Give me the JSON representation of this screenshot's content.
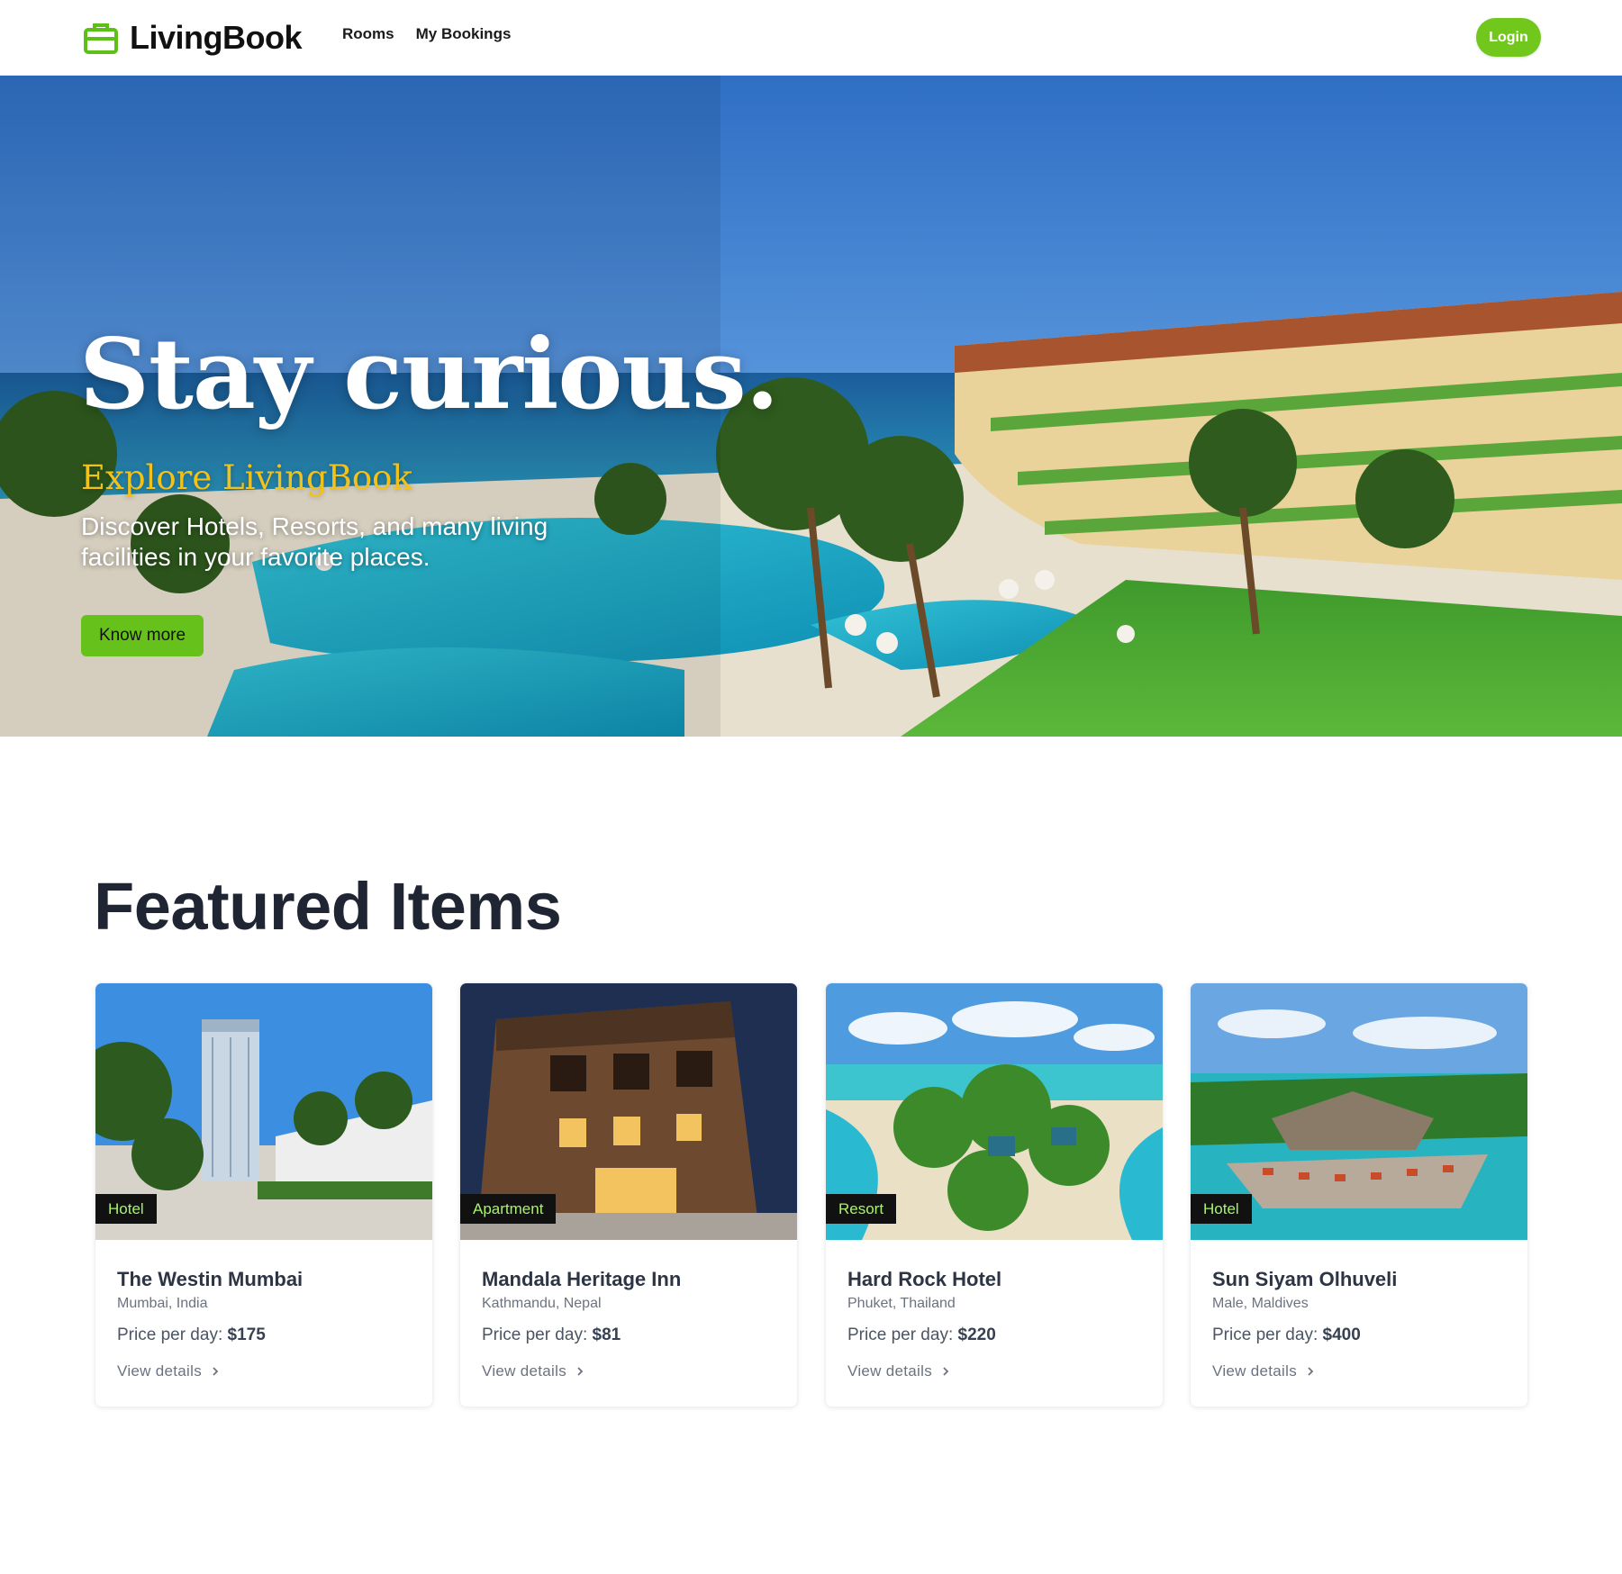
{
  "navbar": {
    "brand": "LivingBook",
    "brand_icon": "briefcase-icon",
    "links": [
      {
        "label": "Rooms"
      },
      {
        "label": "My Bookings"
      }
    ],
    "login_label": "Login"
  },
  "hero": {
    "title": "Stay curious.",
    "subtitle": "Explore LivingBook",
    "description": "Discover Hotels, Resorts, and many living facilities in your favorite places.",
    "button_label": "Know more"
  },
  "featured": {
    "title": "Featured Items",
    "items": [
      {
        "badge": "Hotel",
        "name": "The Westin Mumbai",
        "location": "Mumbai, India",
        "price_label": "Price per day:",
        "price": "$175",
        "link_label": "View details"
      },
      {
        "badge": "Apartment",
        "name": "Mandala Heritage Inn",
        "location": "Kathmandu, Nepal",
        "price_label": "Price per day:",
        "price": "$81",
        "link_label": "View details"
      },
      {
        "badge": "Resort",
        "name": "Hard Rock Hotel",
        "location": "Phuket, Thailand",
        "price_label": "Price per day:",
        "price": "$220",
        "link_label": "View details"
      },
      {
        "badge": "Hotel",
        "name": "Sun Siyam Olhuveli",
        "location": "Male, Maldives",
        "price_label": "Price per day:",
        "price": "$400",
        "link_label": "View details"
      }
    ]
  },
  "colors": {
    "accent_green": "#72c71c",
    "subtitle_gold": "#f2c21b",
    "badge_text": "#a7f36b"
  }
}
